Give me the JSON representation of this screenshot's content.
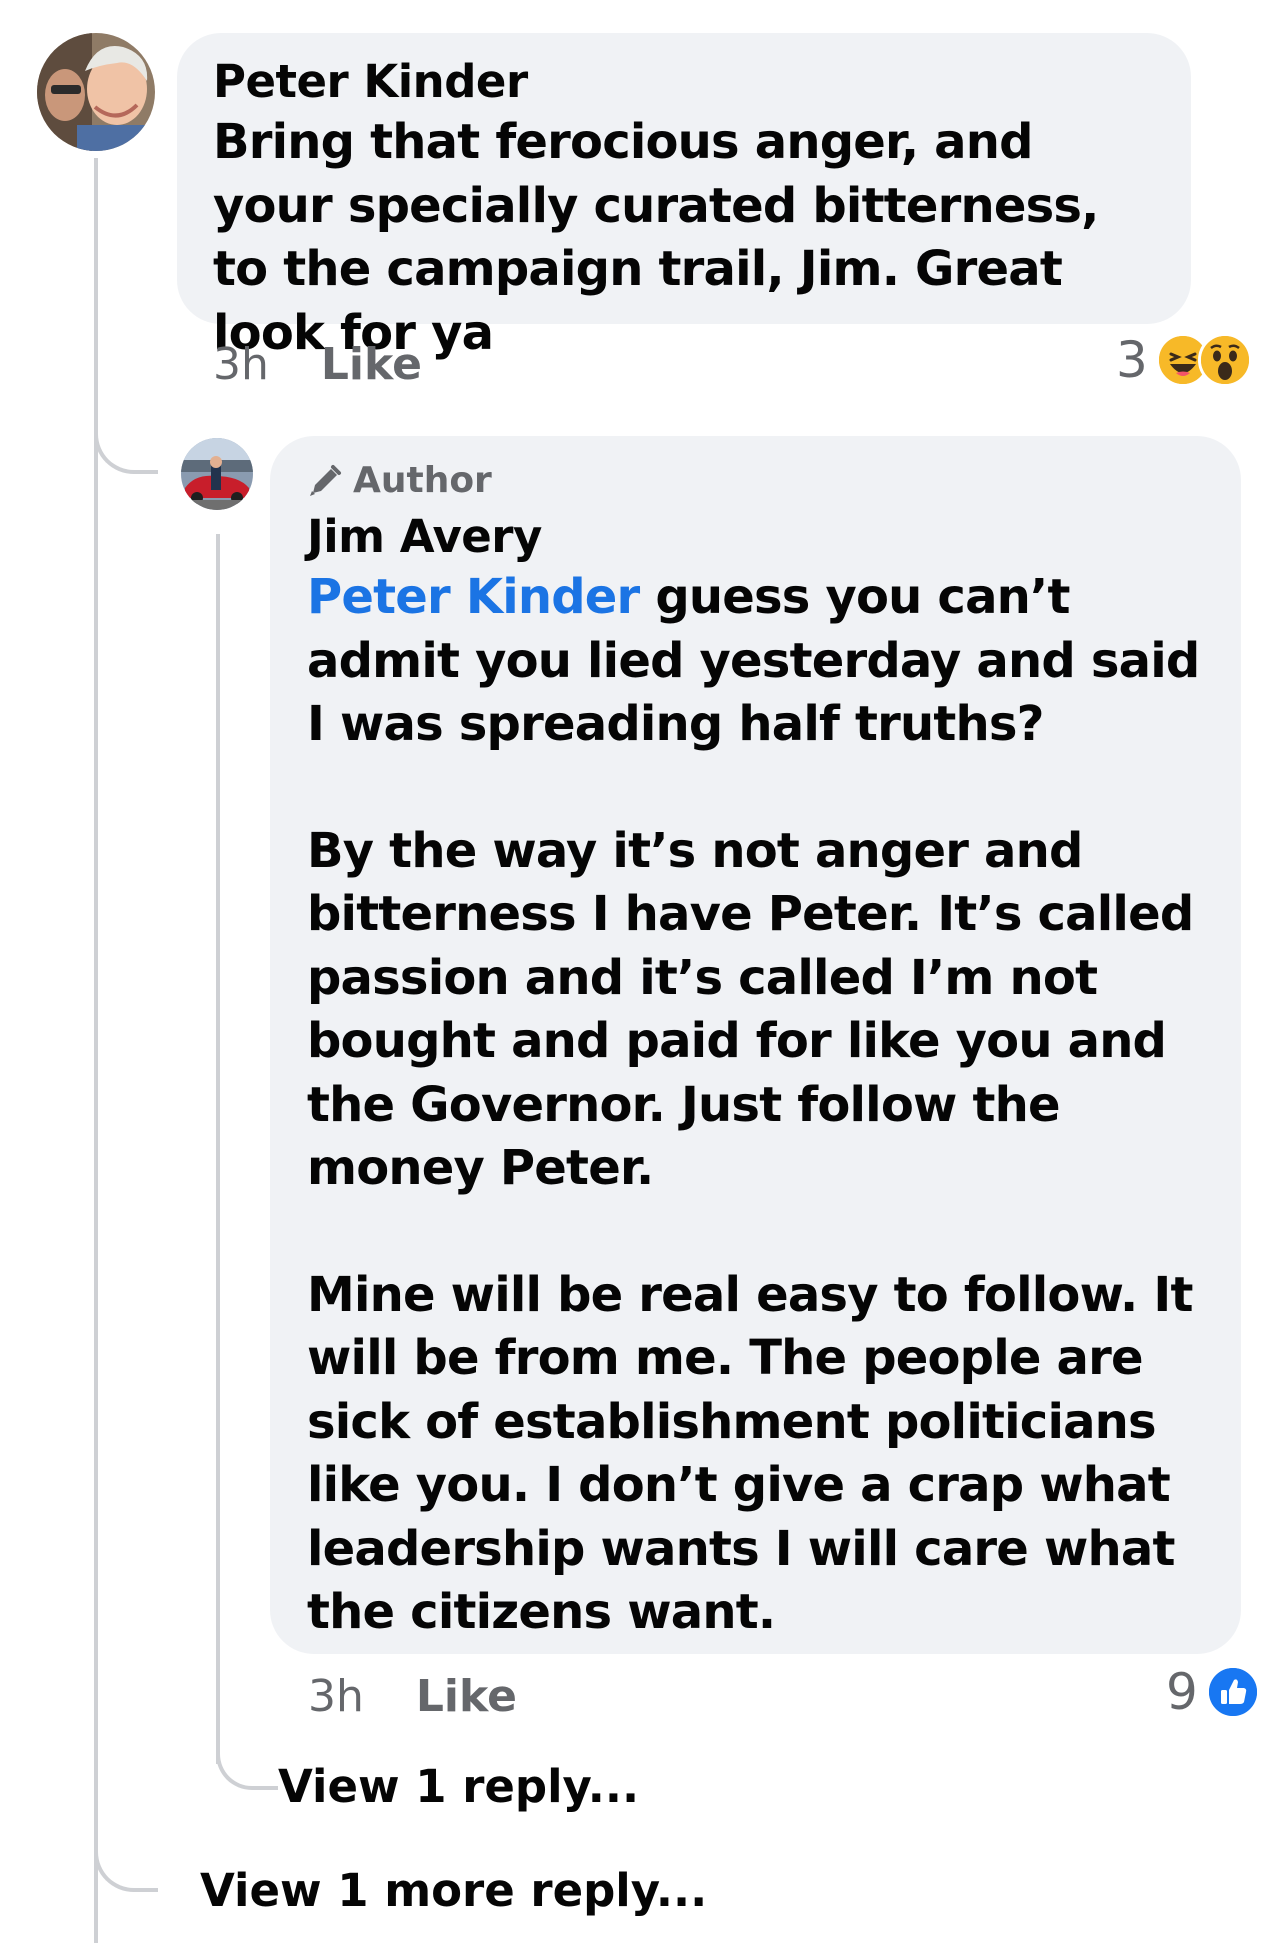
{
  "comment": {
    "author": "Peter Kinder",
    "text": "Bring that ferocious anger, and your specially curated bitterness, to the campaign trail, Jim. Great look for ya",
    "time": "3h",
    "like_label": "Like",
    "reaction_count": "3",
    "reaction_icons": [
      "haha-icon",
      "wow-icon"
    ]
  },
  "reply": {
    "badge": "Author",
    "badge_icon": "pencil-icon",
    "author": "Jim Avery",
    "mention": "Peter Kinder",
    "text_after_mention": " guess you can’t admit you lied yesterday and said I was spreading half truths?",
    "paragraph_2": "By the way it’s not anger and bitterness I have Peter. It’s called passion and it’s called I’m not bought and paid for like you and the Governor. Just follow the money Peter.",
    "paragraph_3": "Mine will be real easy to follow. It will be from me. The people are sick of establishment politicians like you. I don’t give a crap what leadership wants I will care what the citizens want.",
    "time": "3h",
    "like_label": "Like",
    "reaction_count": "9",
    "reaction_icons": [
      "like-icon"
    ]
  },
  "view_nested_reply": "View 1 reply...",
  "view_more_reply": "View 1 more reply...",
  "colors": {
    "bubble": "#f0f2f5",
    "mention": "#1b74e4",
    "meta": "#65676b",
    "thread_line": "#ced0d4",
    "like_blue": "#1877f2"
  }
}
